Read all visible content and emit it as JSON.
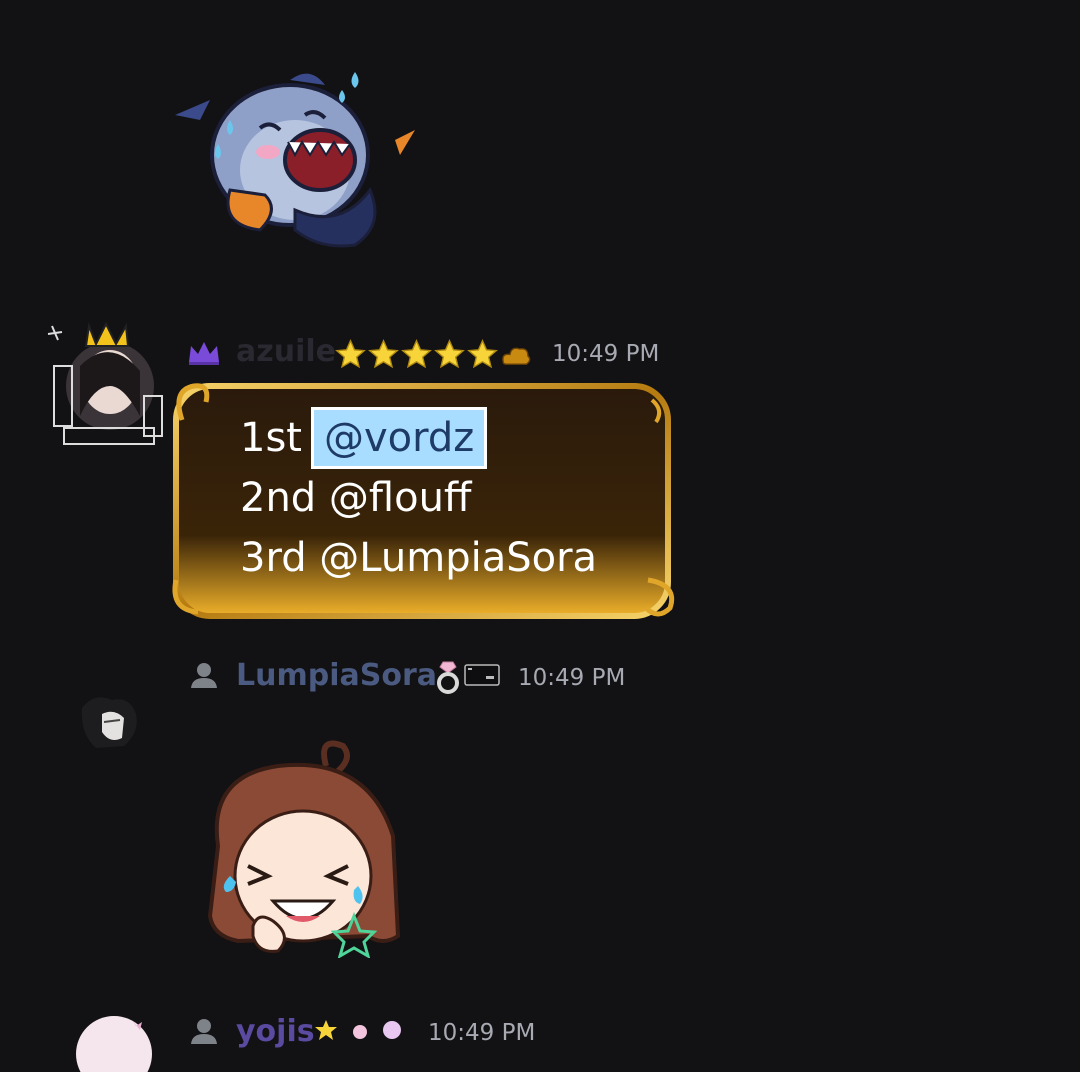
{
  "messages": [
    {
      "username": "azuile",
      "timestamp": "10:49 PM",
      "role_icon": "purple-crown-icon",
      "badges": [
        "star-icon",
        "star-icon",
        "star-icon",
        "star-icon",
        "star-icon",
        "gold-cloud-icon"
      ],
      "lines": [
        {
          "prefix": "1st",
          "mention": "@vordz"
        },
        {
          "text": "2nd @flouff"
        },
        {
          "text": "3rd @LumpiaSora"
        }
      ]
    },
    {
      "username": "LumpiaSora",
      "timestamp": "10:49 PM",
      "role_icon": "person-icon",
      "badges": [
        "ring-icon",
        "tag-icon"
      ],
      "sticker": "laughing-crying-girl-sticker"
    },
    {
      "username": "yojis",
      "timestamp": "10:49 PM",
      "role_icon": "person-icon"
    }
  ],
  "stickers": [
    "laughing-shark-sticker"
  ],
  "colors": {
    "background": "#121113",
    "mention_highlight": "#a8ddff",
    "bubble_gold": "#d9a11c",
    "timestamp": "#a8aab3"
  }
}
